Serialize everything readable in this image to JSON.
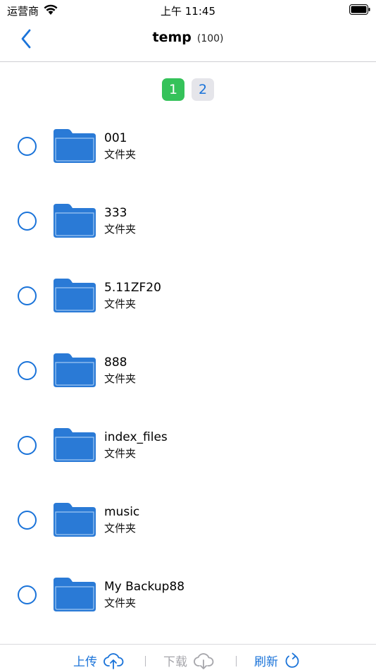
{
  "status_bar": {
    "carrier": "运营商",
    "time": "上午 11:45"
  },
  "nav": {
    "title": "temp",
    "count": "(100)"
  },
  "pagination": {
    "pages": [
      "1",
      "2"
    ],
    "current": "1"
  },
  "files": [
    {
      "name": "001",
      "type": "文件夹"
    },
    {
      "name": "333",
      "type": "文件夹"
    },
    {
      "name": "5.11ZF20",
      "type": "文件夹"
    },
    {
      "name": "888",
      "type": "文件夹"
    },
    {
      "name": "index_files",
      "type": "文件夹"
    },
    {
      "name": "music",
      "type": "文件夹"
    },
    {
      "name": "My Backup88",
      "type": "文件夹"
    }
  ],
  "toolbar": {
    "upload_label": "上传",
    "download_label": "下载",
    "refresh_label": "刷新"
  },
  "icons": {
    "back": "chevron-left-icon",
    "folder": "folder-icon",
    "upload": "cloud-upload-icon",
    "download": "cloud-download-icon",
    "refresh": "refresh-icon"
  },
  "colors": {
    "accent": "#1a73d9",
    "active_page": "#35c25a",
    "disabled": "#a6a6ab",
    "folder": "#2a7ad6"
  }
}
